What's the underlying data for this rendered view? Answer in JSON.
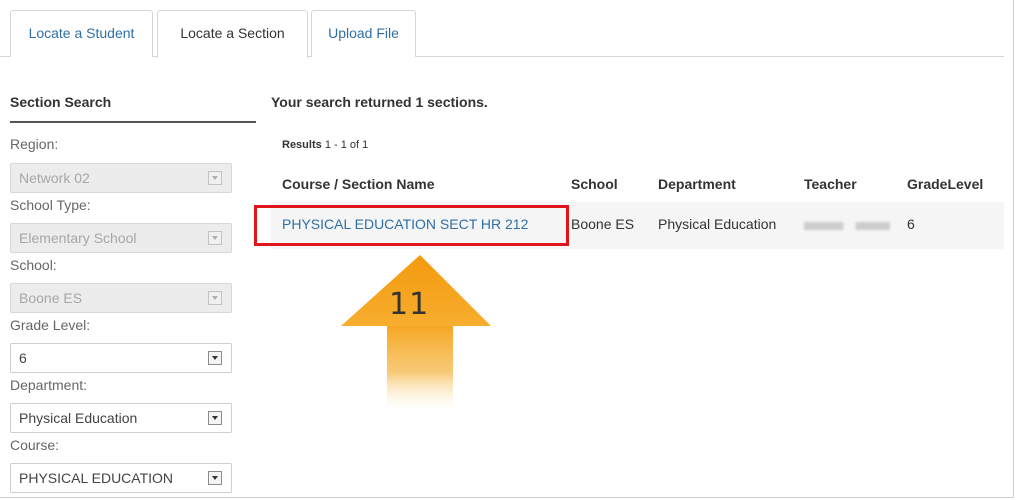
{
  "tabs": [
    {
      "label": "Locate a Student",
      "active": false
    },
    {
      "label": "Locate a Section",
      "active": true
    },
    {
      "label": "Upload File",
      "active": false
    }
  ],
  "search_panel": {
    "title": "Section Search",
    "fields": [
      {
        "label": "Region:",
        "value": "Network 02",
        "disabled": true
      },
      {
        "label": "School Type:",
        "value": "Elementary School",
        "disabled": true
      },
      {
        "label": "School:",
        "value": "Boone ES",
        "disabled": true
      },
      {
        "label": "Grade Level:",
        "value": "6",
        "disabled": false
      },
      {
        "label": "Department:",
        "value": "Physical Education",
        "disabled": false
      },
      {
        "label": "Course:",
        "value": "PHYSICAL EDUCATION",
        "disabled": false
      }
    ]
  },
  "results": {
    "summary": "Your search returned 1 sections.",
    "count_label": "Results",
    "count_range": "1 - 1 of 1",
    "columns": [
      "Course / Section Name",
      "School",
      "Department",
      "Teacher",
      "GradeLevel"
    ],
    "rows": [
      {
        "course": "PHYSICAL EDUCATION SECT HR 212",
        "school": "Boone ES",
        "department": "Physical Education",
        "teacher": "",
        "grade": "6"
      }
    ]
  },
  "annotation": {
    "step": "11",
    "arrow_color": "#f5a31a",
    "highlight_color": "#e0141b"
  },
  "colors": {
    "link": "#2f6fa6",
    "row_bg": "#f5f5f5"
  }
}
